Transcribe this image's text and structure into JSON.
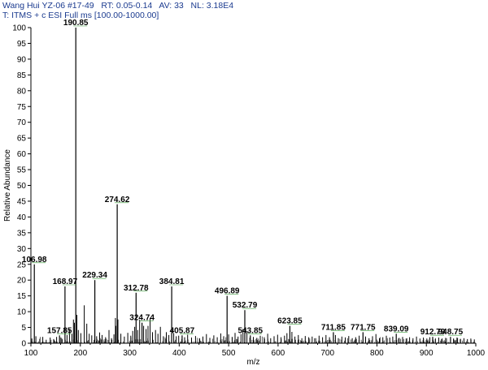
{
  "header": {
    "line1": "Wang Hui YZ-06 #17-49   RT: 0.05-0.14   AV: 33   NL: 3.18E4",
    "line2": "T: ITMS + c ESI Full ms [100.00-1000.00]"
  },
  "chart_data": {
    "type": "line",
    "subtype": "mass-spectrum-stick",
    "xlabel": "m/z",
    "ylabel": "Relative Abundance",
    "xlim": [
      100,
      1000
    ],
    "ylim": [
      0,
      100
    ],
    "x_ticks": [
      100,
      200,
      300,
      400,
      500,
      600,
      700,
      800,
      900,
      1000
    ],
    "y_ticks": [
      0,
      5,
      10,
      15,
      20,
      25,
      30,
      35,
      40,
      45,
      50,
      55,
      60,
      65,
      70,
      75,
      80,
      85,
      90,
      95,
      100
    ],
    "colors": {
      "sticks": "#000000",
      "axes": "#000000",
      "header_text": "#1a3a8f",
      "label_marker": "#3c9c3c"
    },
    "labeled_peaks": [
      {
        "mz": 190.85,
        "label": "190.85",
        "value": 100
      },
      {
        "mz": 274.62,
        "label": "274.62",
        "value": 44
      },
      {
        "mz": 106.98,
        "label": "106.98",
        "value": 25
      },
      {
        "mz": 229.34,
        "label": "229.34",
        "value": 20
      },
      {
        "mz": 168.97,
        "label": "168.97",
        "value": 18
      },
      {
        "mz": 384.81,
        "label": "384.81",
        "value": 18
      },
      {
        "mz": 496.89,
        "label": "496.89",
        "value": 15
      },
      {
        "mz": 312.78,
        "label": "312.78",
        "value": 16
      },
      {
        "mz": 532.79,
        "label": "532.79",
        "value": 10.5
      },
      {
        "mz": 324.74,
        "label": "324.74",
        "value": 6.5
      },
      {
        "mz": 623.85,
        "label": "623.85",
        "value": 5.5
      },
      {
        "mz": 711.85,
        "label": "711.85",
        "value": 3.5
      },
      {
        "mz": 771.75,
        "label": "771.75",
        "value": 3.5
      },
      {
        "mz": 839.09,
        "label": "839.09",
        "value": 3
      },
      {
        "mz": 405.87,
        "label": "405.87",
        "value": 2.5
      },
      {
        "mz": 543.85,
        "label": "543.85",
        "value": 2.5
      },
      {
        "mz": 157.85,
        "label": "157.85",
        "value": 2.5
      },
      {
        "mz": 912.79,
        "label": "912.79",
        "value": 2
      },
      {
        "mz": 948.75,
        "label": "948.75",
        "value": 2
      }
    ],
    "minor_peaks": [
      [
        102,
        1.5
      ],
      [
        110,
        2.2
      ],
      [
        118,
        1.4
      ],
      [
        124,
        2
      ],
      [
        131,
        1.1
      ],
      [
        139,
        1.8
      ],
      [
        146,
        1.3
      ],
      [
        152,
        2
      ],
      [
        163,
        1.4
      ],
      [
        173,
        2.6
      ],
      [
        178,
        4.5
      ],
      [
        183,
        3
      ],
      [
        186,
        7.5
      ],
      [
        188,
        6.5
      ],
      [
        193,
        9
      ],
      [
        196,
        4.2
      ],
      [
        201,
        3.2
      ],
      [
        208,
        12
      ],
      [
        213,
        6.2
      ],
      [
        218,
        3
      ],
      [
        223,
        2.5
      ],
      [
        233,
        2.2
      ],
      [
        239,
        3.4
      ],
      [
        244,
        2.6
      ],
      [
        251,
        1.9
      ],
      [
        258,
        4.2
      ],
      [
        263,
        1.6
      ],
      [
        268,
        2.8
      ],
      [
        271,
        8
      ],
      [
        272,
        5.5
      ],
      [
        276,
        7.5
      ],
      [
        282,
        3
      ],
      [
        289,
        2.1
      ],
      [
        296,
        3.3
      ],
      [
        302,
        2.4
      ],
      [
        306,
        3.9
      ],
      [
        310,
        5.2
      ],
      [
        316,
        4.2
      ],
      [
        320,
        7.5
      ],
      [
        328,
        5.5
      ],
      [
        333,
        4.5
      ],
      [
        337,
        5.5
      ],
      [
        341,
        8
      ],
      [
        346,
        3.5
      ],
      [
        352,
        4.2
      ],
      [
        357,
        3
      ],
      [
        362,
        5.2
      ],
      [
        368,
        2.2
      ],
      [
        374,
        3.5
      ],
      [
        379,
        2.6
      ],
      [
        389,
        3.2
      ],
      [
        394,
        2.2
      ],
      [
        399,
        2.4
      ],
      [
        411,
        1.9
      ],
      [
        417,
        2.7
      ],
      [
        425,
        1.8
      ],
      [
        433,
        2.3
      ],
      [
        441,
        1.6
      ],
      [
        448,
        2.1
      ],
      [
        455,
        2.9
      ],
      [
        462,
        1.7
      ],
      [
        470,
        2.5
      ],
      [
        477,
        1.9
      ],
      [
        484,
        3.1
      ],
      [
        490,
        2.2
      ],
      [
        500,
        2.8
      ],
      [
        507,
        2
      ],
      [
        513,
        3.3
      ],
      [
        519,
        2.1
      ],
      [
        525,
        2.9
      ],
      [
        529,
        4.5
      ],
      [
        537,
        3.5
      ],
      [
        550,
        2
      ],
      [
        557,
        1.7
      ],
      [
        564,
        2.4
      ],
      [
        572,
        1.9
      ],
      [
        579,
        3
      ],
      [
        585,
        1.6
      ],
      [
        592,
        2.2
      ],
      [
        599,
        2.7
      ],
      [
        606,
        1.9
      ],
      [
        613,
        2.4
      ],
      [
        618,
        3.2
      ],
      [
        628,
        3.6
      ],
      [
        634,
        2.1
      ],
      [
        641,
        2.6
      ],
      [
        648,
        1.6
      ],
      [
        655,
        2.3
      ],
      [
        662,
        1.9
      ],
      [
        669,
        2.1
      ],
      [
        676,
        1.6
      ],
      [
        683,
        2.4
      ],
      [
        690,
        1.9
      ],
      [
        697,
        2.6
      ],
      [
        704,
        1.9
      ],
      [
        716,
        2.6
      ],
      [
        722,
        1.6
      ],
      [
        729,
        2.1
      ],
      [
        736,
        1.8
      ],
      [
        743,
        2.3
      ],
      [
        750,
        1.6
      ],
      [
        757,
        1.9
      ],
      [
        764,
        2.4
      ],
      [
        777,
        2.1
      ],
      [
        784,
        1.6
      ],
      [
        791,
        2.2
      ],
      [
        798,
        2.9
      ],
      [
        805,
        1.6
      ],
      [
        812,
        1.9
      ],
      [
        819,
        2.4
      ],
      [
        826,
        1.8
      ],
      [
        832,
        2.1
      ],
      [
        845,
        1.7
      ],
      [
        852,
        2
      ],
      [
        859,
        1.5
      ],
      [
        866,
        1.9
      ],
      [
        873,
        1.6
      ],
      [
        880,
        2.1
      ],
      [
        887,
        1.5
      ],
      [
        894,
        1.8
      ],
      [
        901,
        1.5
      ],
      [
        907,
        1.9
      ],
      [
        918,
        1.4
      ],
      [
        925,
        1.8
      ],
      [
        932,
        1.5
      ],
      [
        939,
        1.7
      ],
      [
        955,
        1.5
      ],
      [
        962,
        1.8
      ],
      [
        969,
        1.4
      ],
      [
        976,
        1.6
      ],
      [
        983,
        1.3
      ],
      [
        990,
        1.5
      ],
      [
        997,
        1.2
      ]
    ]
  }
}
